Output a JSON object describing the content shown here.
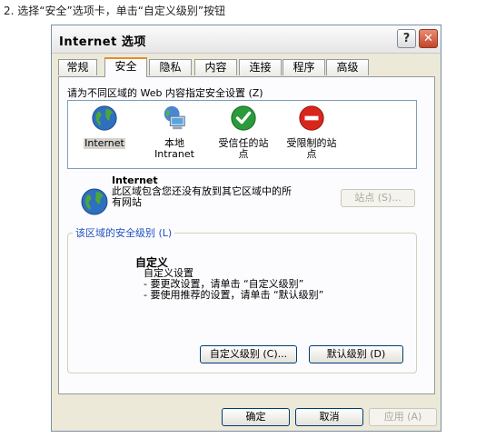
{
  "caption": "2. 选择“安全”选项卡，单击“自定义级别”按钮",
  "dialog": {
    "title": "Internet 选项",
    "help_label": "?",
    "close_label": "✕"
  },
  "tabs": [
    {
      "label": "常规"
    },
    {
      "label": "安全"
    },
    {
      "label": "隐私"
    },
    {
      "label": "内容"
    },
    {
      "label": "连接"
    },
    {
      "label": "程序"
    },
    {
      "label": "高级"
    }
  ],
  "security": {
    "zone_prompt": "请为不同区域的 Web 内容指定安全设置 (Z)",
    "zones": [
      {
        "label": "Internet",
        "icon": "globe-icon"
      },
      {
        "label": "本地\nIntranet",
        "icon": "computer-globe-icon"
      },
      {
        "label": "受信任的站\n点",
        "icon": "checkmark-icon"
      },
      {
        "label": "受限制的站\n点",
        "icon": "no-entry-icon"
      }
    ],
    "selected_zone": "Internet",
    "zone_name": "Internet",
    "zone_description": "此区域包含您还没有放到其它区域中的所有网站",
    "sites_button": "站点 (S)...",
    "level_group_label": "该区域的安全级别 (L)",
    "level_title": "自定义",
    "level_desc_lines": [
      "自定义设置",
      "- 要更改设置，请单击 “自定义级别”",
      "- 要使用推荐的设置，请单击 “默认级别”"
    ],
    "custom_level_button": "自定义级别 (C)...",
    "default_level_button": "默认级别 (D)"
  },
  "footer": {
    "ok": "确定",
    "cancel": "取消",
    "apply": "应用 (A)"
  },
  "colors": {
    "dialog_bg": "#ece9d8",
    "active_tab_accent": "#e68b2c",
    "group_label": "#2050c0",
    "close_button": "#c2452a"
  }
}
